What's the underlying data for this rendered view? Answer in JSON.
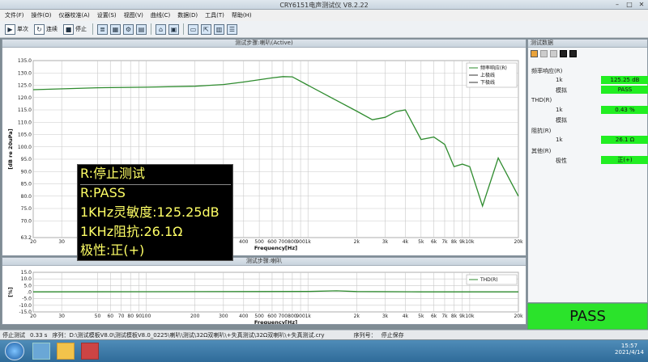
{
  "window": {
    "title": "CRY6151电声测试仪 V8.2.22"
  },
  "menu": [
    "文件(F)",
    "操作(O)",
    "仪器校准(A)",
    "设置(S)",
    "视图(V)",
    "曲线(C)",
    "数据(D)",
    "工具(T)",
    "帮助(H)"
  ],
  "toolbar": {
    "single_label": "单次",
    "continuous_label": "连续",
    "stop_label": "停止"
  },
  "main_chart": {
    "title": "测试步骤:喇叭(Active)",
    "ylabel": "[dB re 20uPa]",
    "xlabel": "Frequency[Hz]",
    "legend": [
      "频率响应(R)",
      "上极线",
      "下极线"
    ],
    "yticks": [
      "135.0",
      "130.0",
      "125.0",
      "120.0",
      "115.0",
      "110.0",
      "105.0",
      "100.0",
      "95.0",
      "90.0",
      "85.0",
      "80.0",
      "75.0",
      "70.0",
      "63.2"
    ],
    "xticks": [
      "20",
      "30",
      "50",
      "60",
      "70",
      "80",
      "90",
      "100",
      "200",
      "300",
      "400",
      "500",
      "600",
      "700",
      "800",
      "900",
      "1k",
      "2k",
      "3k",
      "4k",
      "5k",
      "6k",
      "7k",
      "8k",
      "9k",
      "10k",
      "20k"
    ]
  },
  "thd_chart": {
    "title": "测试步骤:喇叭",
    "ylabel": "[%]",
    "xlabel": "Frequency[Hz]",
    "legend": [
      "THD(R)"
    ],
    "yticks": [
      "15.0",
      "10.0",
      "5.0",
      ".0",
      "-5.0",
      "-10.0",
      "-15.0"
    ]
  },
  "chart_data": [
    {
      "type": "line",
      "title": "测试步骤:喇叭(Active)",
      "xlabel": "Frequency[Hz]",
      "ylabel": "[dB re 20uPa]",
      "xscale": "log",
      "xlim": [
        20,
        20000
      ],
      "ylim": [
        63.2,
        135.0
      ],
      "grid": true,
      "legend_position": "top-right",
      "series": [
        {
          "name": "频率响应(R)",
          "color": "#2e8b2e",
          "x": [
            20,
            50,
            100,
            200,
            300,
            400,
            600,
            700,
            800,
            1000,
            1300,
            2000,
            2500,
            3000,
            3500,
            4000,
            5000,
            6000,
            7000,
            8000,
            9000,
            10000,
            12000,
            15000,
            20000
          ],
          "y": [
            123.2,
            124.0,
            124.2,
            124.6,
            125.3,
            126.3,
            128.0,
            128.5,
            128.4,
            125.0,
            121.0,
            114.5,
            111.0,
            112.0,
            114.3,
            115.0,
            103.0,
            104.0,
            101.0,
            92.0,
            93.0,
            92.0,
            76.0,
            95.5,
            80.0
          ]
        }
      ]
    },
    {
      "type": "line",
      "title": "测试步骤:喇叭",
      "xlabel": "Frequency[Hz]",
      "ylabel": "[%]",
      "xscale": "log",
      "xlim": [
        20,
        20000
      ],
      "ylim": [
        -15.0,
        15.0
      ],
      "grid": true,
      "legend_position": "top-right",
      "series": [
        {
          "name": "THD(R)",
          "color": "#2e8b2e",
          "x": [
            20,
            100,
            500,
            1000,
            1500,
            2000,
            5000,
            20000
          ],
          "y": [
            0.2,
            0.3,
            0.4,
            0.5,
            1.0,
            0.4,
            0.2,
            0.2
          ]
        }
      ]
    }
  ],
  "overlay": {
    "line1": "R:停止测试",
    "line2": "R:PASS",
    "line3": "1KHz灵敏度:125.25dB",
    "line4": "1KHz阻抗:26.1Ω",
    "line5": "极性:正(+)"
  },
  "side": {
    "title": "测试数据",
    "sections": [
      {
        "name": "频率响应(R)",
        "rows": [
          {
            "k": "1k",
            "v": "125.25 dB"
          },
          {
            "k": "模拟",
            "v": "PASS"
          }
        ]
      },
      {
        "name": "THD(R)",
        "rows": [
          {
            "k": "1k",
            "v": "0.43 %"
          },
          {
            "k": "模拟",
            "v": ""
          }
        ]
      },
      {
        "name": "阻抗(R)",
        "rows": [
          {
            "k": "1k",
            "v": "26.1 Ω"
          }
        ]
      },
      {
        "name": "其他(R)",
        "rows": [
          {
            "k": "极性",
            "v": "正(+)"
          }
        ]
      }
    ]
  },
  "pass_label": "PASS",
  "status": {
    "state": "停止测试",
    "time": "0.33 s",
    "sequence": "序列：D:\\测试模板V8.0\\测试模板V8.0_0225\\喇叭\\测试\\32Ω双喇叭\\+失真测试\\32Ω双喇叭\\+失真测试.cry",
    "seq_no": "序列号：",
    "save": "停止保存"
  },
  "taskbar": {
    "time": "15:57",
    "date": "2021/4/14"
  }
}
